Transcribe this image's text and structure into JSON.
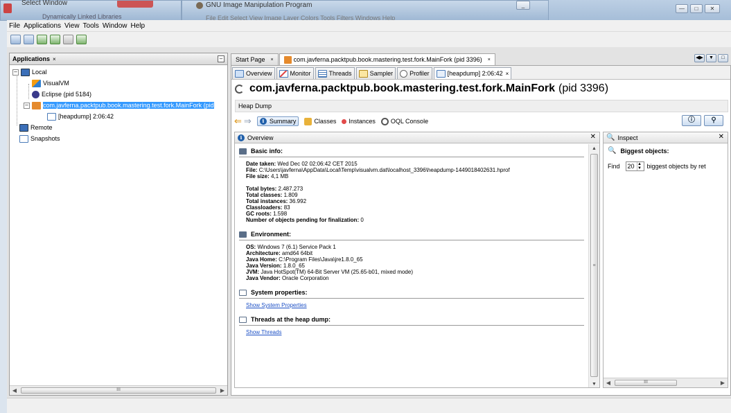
{
  "background": {
    "left_window_title": "Select Window",
    "left_window_sub": "Dynamically Linked Libraries",
    "gimp_title": "GNU Image Manipulation Program",
    "gimp_menu": "File  Edit  Select  View  Image  Layer  Colors  Tools  Filters  Windows  Help"
  },
  "menubar": [
    "File",
    "Applications",
    "View",
    "Tools",
    "Window",
    "Help"
  ],
  "applications_panel": {
    "title": "Applications",
    "close": "×",
    "tree": {
      "local": "Local",
      "visualvm": "VisualVM",
      "eclipse": "Eclipse (pid 5184)",
      "mainfork": "com.javferna.packtpub.book.mastering.test.fork.MainFork (pid",
      "heapdump": "[heapdump] 2:06:42",
      "remote": "Remote",
      "snapshots": "Snapshots"
    },
    "scroll_thumb": "III"
  },
  "doc_tabs": [
    {
      "label": "Start Page",
      "close": "×"
    },
    {
      "label": "com.javferna.packtpub.book.mastering.test.fork.MainFork (pid 3396)",
      "close": "×"
    }
  ],
  "view_tabs": [
    {
      "label": "Overview"
    },
    {
      "label": "Monitor"
    },
    {
      "label": "Threads"
    },
    {
      "label": "Sampler"
    },
    {
      "label": "Profiler"
    },
    {
      "label": "[heapdump] 2:06:42",
      "close": "×"
    }
  ],
  "app_title": "com.javferna.packtpub.book.mastering.test.fork.MainFork",
  "app_pid": "(pid 3396)",
  "heap_dump_label": "Heap Dump",
  "heap_tools": {
    "summary": "Summary",
    "classes": "Classes",
    "instances": "Instances",
    "oql": "OQL Console"
  },
  "overview": {
    "header": "Overview",
    "basic_info": {
      "title": "Basic info:",
      "date_label": "Date taken:",
      "date_value": "Wed Dec 02 02:06:42 CET 2015",
      "file_label": "File:",
      "file_value": "C:\\Users\\javferna\\AppData\\Local\\Temp\\visualvm.dat\\localhost_3396\\heapdump-1449018402631.hprof",
      "size_label": "File size:",
      "size_value": "4,1 MB",
      "bytes_label": "Total bytes:",
      "bytes_value": "2.487.273",
      "classes_label": "Total classes:",
      "classes_value": "1.809",
      "instances_label": "Total instances:",
      "instances_value": "36.992",
      "loaders_label": "Classloaders:",
      "loaders_value": "83",
      "gcroots_label": "GC roots:",
      "gcroots_value": "1.598",
      "pending_label": "Number of objects pending for finalization:",
      "pending_value": "0"
    },
    "environment": {
      "title": "Environment:",
      "os_label": "OS:",
      "os_value": "Windows 7 (6.1) Service Pack 1",
      "arch_label": "Architecture:",
      "arch_value": "amd64 64bit",
      "home_label": "Java Home:",
      "home_value": "C:\\Program Files\\Java\\jre1.8.0_65",
      "ver_label": "Java Version:",
      "ver_value": "1.8.0_65",
      "jvm_label": "JVM:",
      "jvm_value": "Java HotSpot(TM) 64-Bit Server VM (25.65-b01, mixed mode)",
      "vendor_label": "Java Vendor:",
      "vendor_value": "Oracle Corporation"
    },
    "sysprops": {
      "title": "System properties:",
      "link": "Show System Properties"
    },
    "threads": {
      "title": "Threads at the heap dump:",
      "link": "Show Threads"
    }
  },
  "inspect": {
    "header": "Inspect",
    "biggest": "Biggest objects:",
    "find": "Find",
    "count": "20",
    "suffix": "biggest objects by ret",
    "scroll_thumb": "III"
  }
}
